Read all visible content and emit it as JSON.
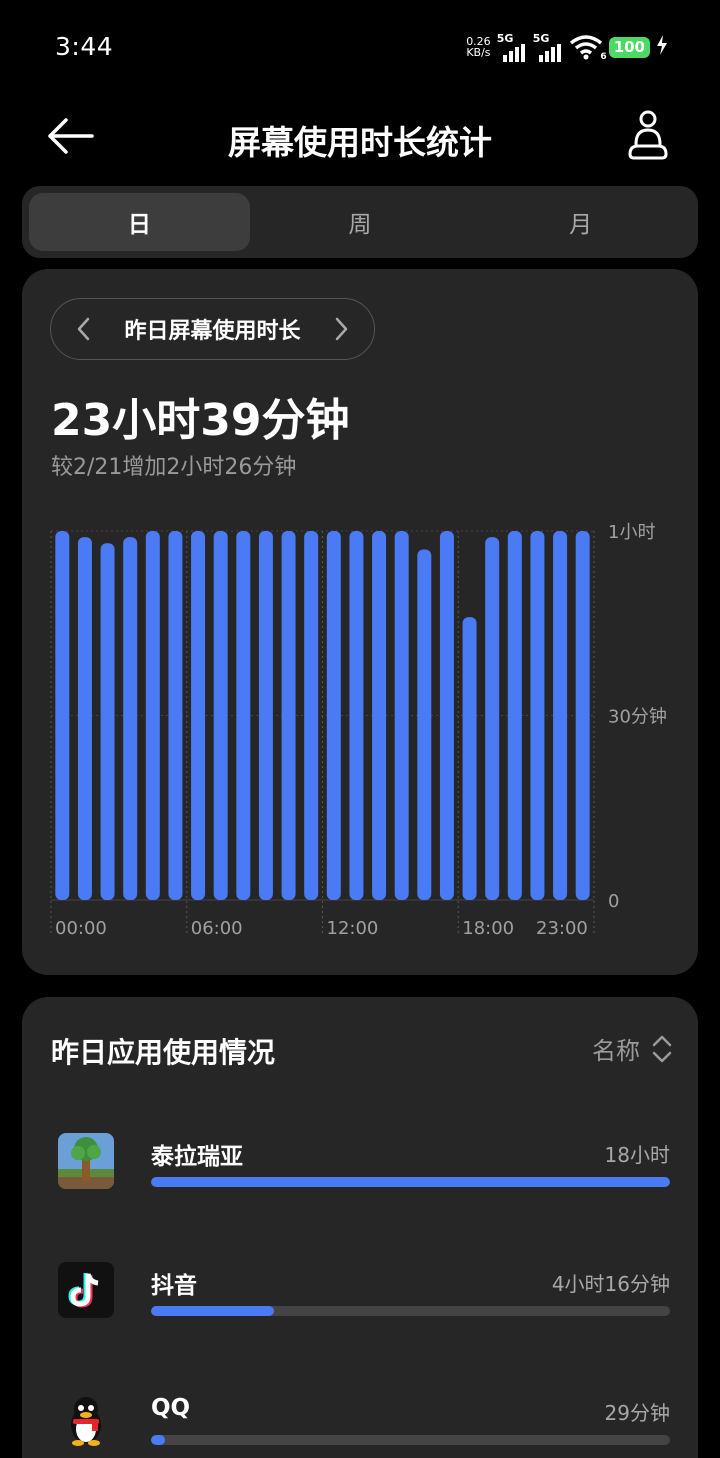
{
  "status_bar": {
    "time": "3:44",
    "net_speed_value": "0.26",
    "net_speed_unit": "KB/s",
    "sim1": "5G",
    "sim2": "5G",
    "wifi_badge": "6",
    "battery": "100"
  },
  "header": {
    "title": "屏幕使用时长统计"
  },
  "tabs": [
    {
      "label": "日",
      "active": true
    },
    {
      "label": "周",
      "active": false
    },
    {
      "label": "月",
      "active": false
    }
  ],
  "summary": {
    "period_label": "昨日屏幕使用时长",
    "total": "23小时39分钟",
    "comparison": "较2/21增加2小时26分钟"
  },
  "chart_data": {
    "type": "bar",
    "categories": [
      "00:00",
      "01:00",
      "02:00",
      "03:00",
      "04:00",
      "05:00",
      "06:00",
      "07:00",
      "08:00",
      "09:00",
      "10:00",
      "11:00",
      "12:00",
      "13:00",
      "14:00",
      "15:00",
      "16:00",
      "17:00",
      "18:00",
      "19:00",
      "20:00",
      "21:00",
      "22:00",
      "23:00"
    ],
    "values": [
      60,
      59,
      58,
      59,
      60,
      60,
      60,
      60,
      60,
      60,
      60,
      60,
      60,
      60,
      60,
      60,
      57,
      60,
      46,
      59,
      60,
      60,
      60,
      60
    ],
    "unit": "minutes",
    "ylim": [
      0,
      60
    ],
    "y_tick_labels": [
      "0",
      "30分钟",
      "1小时"
    ],
    "x_tick_labels": [
      "00:00",
      "06:00",
      "12:00",
      "18:00",
      "23:00"
    ],
    "bar_color": "#4a7bf5",
    "grid": true
  },
  "apps_section": {
    "title": "昨日应用使用情况",
    "sort_label": "名称",
    "apps": [
      {
        "name": "泰拉瑞亚",
        "time": "18小时",
        "fraction": 1.0,
        "icon": "terraria-app-icon"
      },
      {
        "name": "抖音",
        "time": "4小时16分钟",
        "fraction": 0.237,
        "icon": "douyin-app-icon"
      },
      {
        "name": "QQ",
        "time": "29分钟",
        "fraction": 0.027,
        "icon": "qq-app-icon"
      }
    ]
  },
  "colors": {
    "accent": "#4a7bf5",
    "card": "#262626",
    "background": "#000000",
    "battery": "#4cd964"
  }
}
